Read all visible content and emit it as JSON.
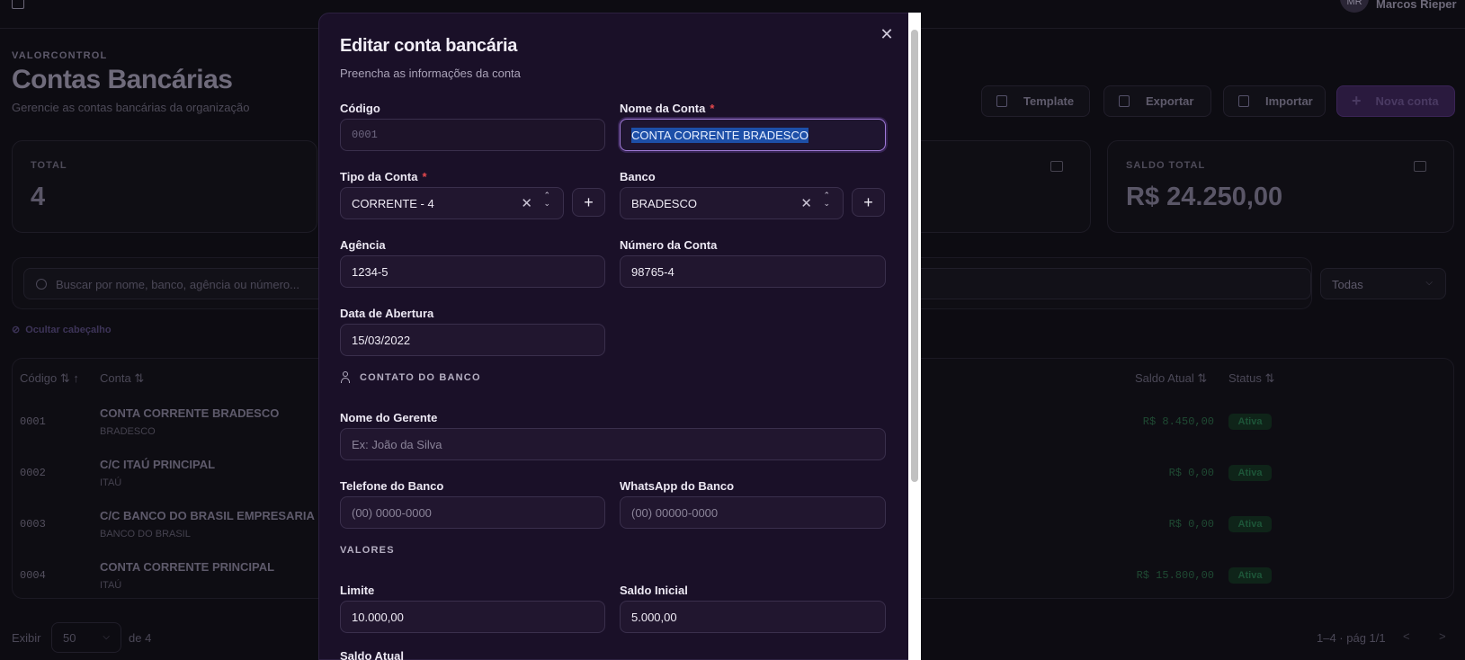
{
  "background": {
    "user": {
      "initials": "MR",
      "name": "Marcos Rieper"
    },
    "org": "VALORCONTROL",
    "title": "Contas Bancárias",
    "subtitle": "Gerencie as contas bancárias da organização",
    "buttons": {
      "template": "Template",
      "exportar": "Exportar",
      "importar": "Importar",
      "nova": "Nova conta"
    },
    "stats": [
      {
        "label": "TOTAL",
        "value": "4"
      },
      {
        "label": "SALDO TOTAL",
        "value": "R$ 24.250,00"
      }
    ],
    "search_placeholder": "Buscar por nome, banco, agência ou número...",
    "filter_value": "Todas",
    "hide_header": "Ocultar cabeçalho",
    "columns": {
      "codigo": "Código",
      "conta": "Conta",
      "saldo": "Saldo Atual",
      "status": "Status"
    },
    "rows": [
      {
        "code": "0001",
        "name": "CONTA CORRENTE BRADESCO",
        "bank": "BRADESCO",
        "saldo": "R$ 8.450,00",
        "status": "Ativa"
      },
      {
        "code": "0002",
        "name": "C/C ITAÚ PRINCIPAL",
        "bank": "ITAÚ",
        "saldo": "R$ 0,00",
        "status": "Ativa"
      },
      {
        "code": "0003",
        "name": "C/C BANCO DO BRASIL EMPRESARIA",
        "bank": "BANCO DO BRASIL",
        "saldo": "R$ 0,00",
        "status": "Ativa"
      },
      {
        "code": "0004",
        "name": "CONTA CORRENTE PRINCIPAL",
        "bank": "ITAÚ",
        "saldo": "R$ 15.800,00",
        "status": "Ativa"
      }
    ],
    "footer": {
      "exibir": "Exibir",
      "page_size": "50",
      "de": "de 4",
      "pagination": "1–4 · pág 1/1"
    }
  },
  "modal": {
    "title": "Editar conta bancária",
    "subtitle": "Preencha as informações da conta",
    "fields": {
      "codigo": {
        "label": "Código",
        "value": "0001"
      },
      "nome": {
        "label": "Nome da Conta",
        "value": "CONTA CORRENTE BRADESCO"
      },
      "tipo": {
        "label": "Tipo da Conta",
        "value": "CORRENTE - 4"
      },
      "banco": {
        "label": "Banco",
        "value": "BRADESCO"
      },
      "agencia": {
        "label": "Agência",
        "value": "1234-5"
      },
      "numero": {
        "label": "Número da Conta",
        "value": "98765-4"
      },
      "abertura": {
        "label": "Data de Abertura",
        "value": "15/03/2022"
      },
      "gerente": {
        "label": "Nome do Gerente",
        "placeholder": "Ex: João da Silva"
      },
      "telefone": {
        "label": "Telefone do Banco",
        "placeholder": "(00) 0000-0000"
      },
      "whatsapp": {
        "label": "WhatsApp do Banco",
        "placeholder": "(00) 00000-0000"
      },
      "limite": {
        "label": "Limite",
        "value": "10.000,00"
      },
      "saldo_inicial": {
        "label": "Saldo Inicial",
        "value": "5.000,00"
      },
      "saldo_atual": {
        "label": "Saldo Atual"
      }
    },
    "sections": {
      "contato": "CONTATO DO BANCO",
      "valores": "VALORES"
    }
  }
}
